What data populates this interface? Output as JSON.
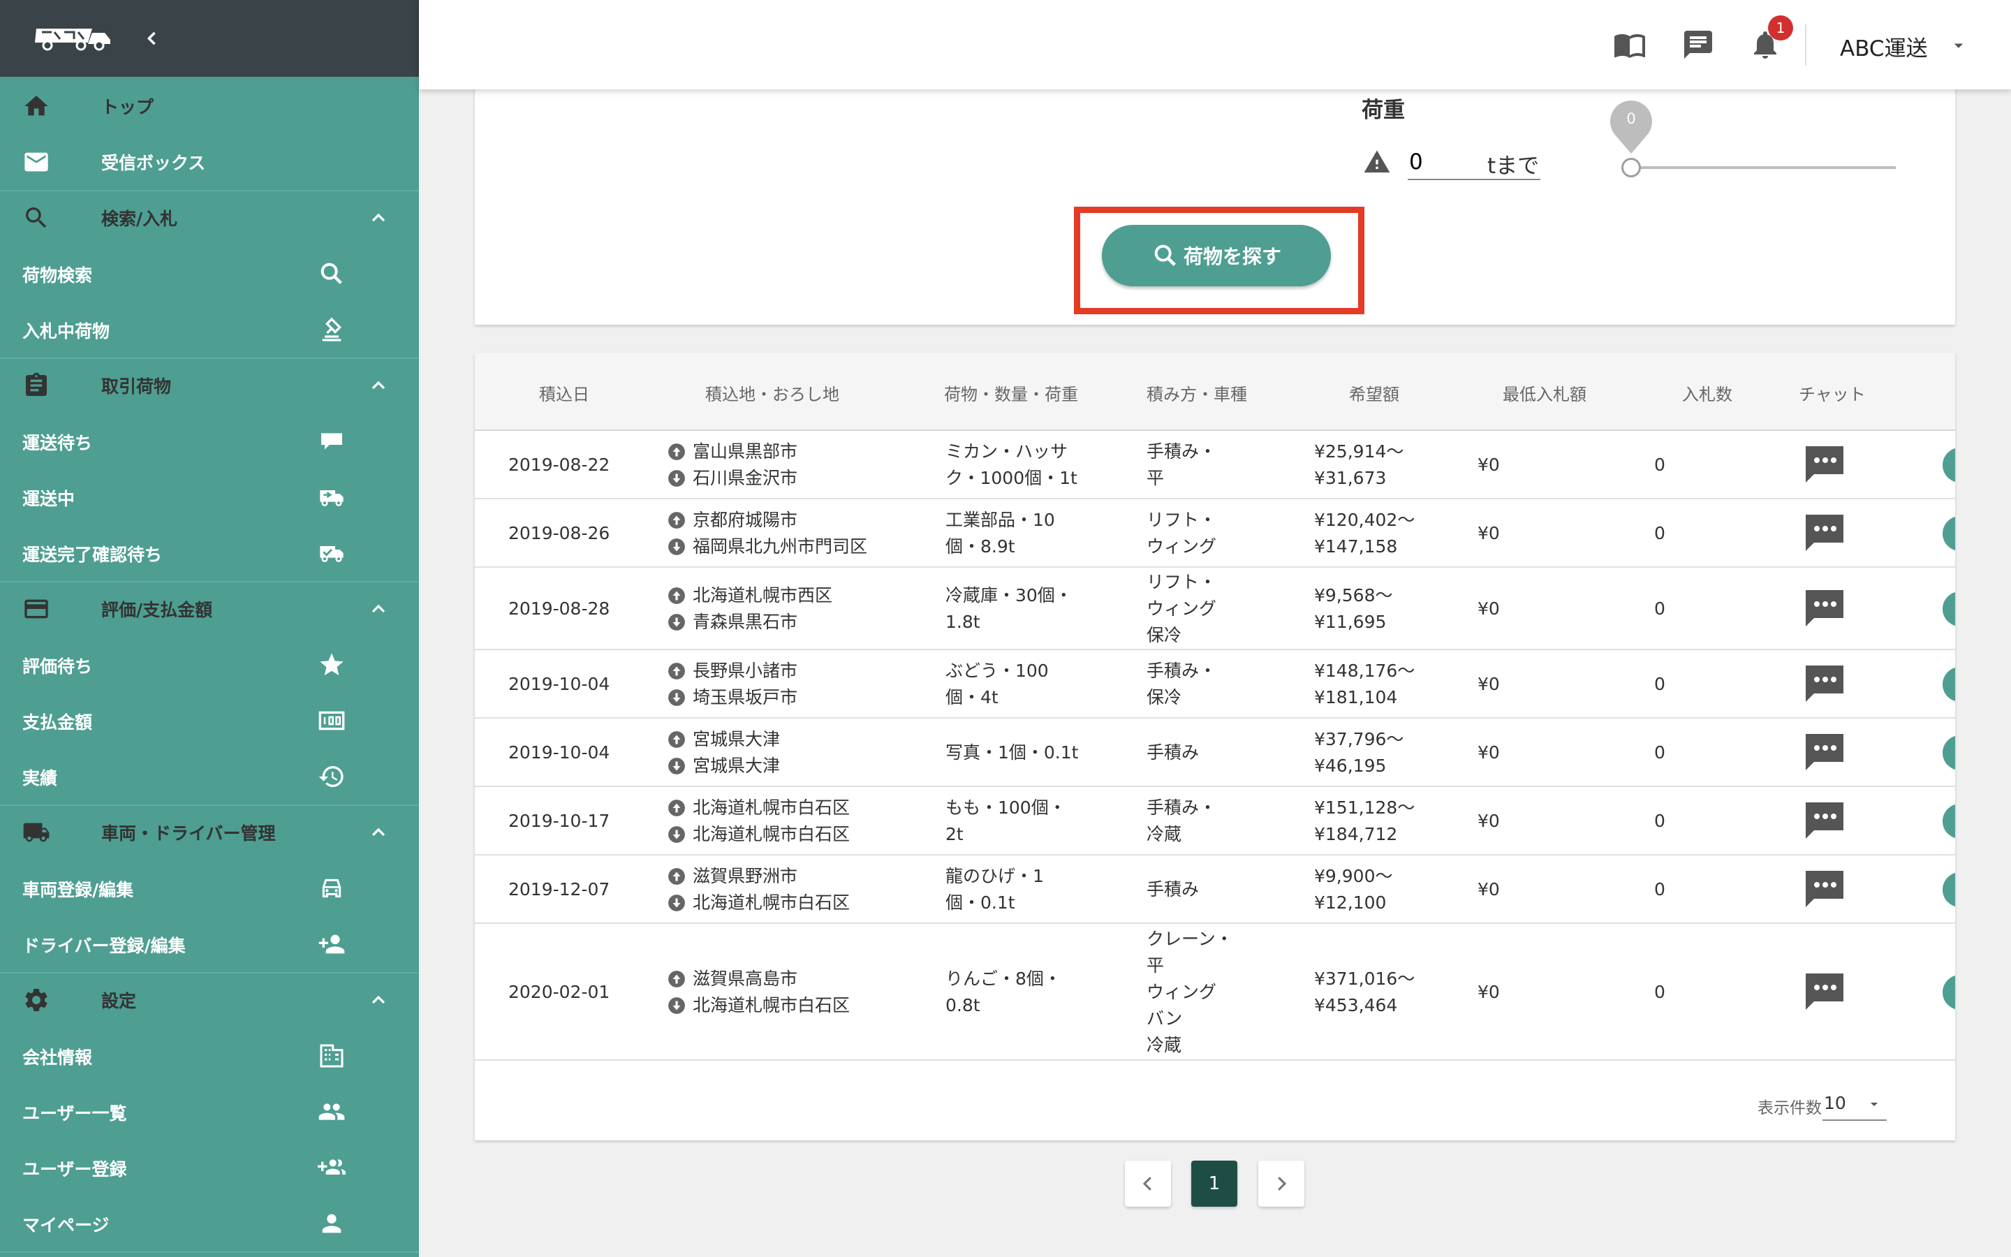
{
  "sidebar": {
    "items": [
      {
        "label": "トップ",
        "icon": "home-icon"
      },
      {
        "label": "受信ボックス",
        "icon": "mail-icon"
      }
    ],
    "groups": [
      {
        "label": "検索/入札",
        "icon": "search-icon",
        "children": [
          {
            "label": "荷物検索",
            "icon": "search-icon"
          },
          {
            "label": "入札中荷物",
            "icon": "bid-icon"
          }
        ]
      },
      {
        "label": "取引荷物",
        "icon": "clipboard-icon",
        "children": [
          {
            "label": "運送待ち",
            "icon": "truck-waiting-icon"
          },
          {
            "label": "運送中",
            "icon": "truck-moving-icon"
          },
          {
            "label": "運送完了確認待ち",
            "icon": "truck-check-icon"
          }
        ]
      },
      {
        "label": "評価/支払金額",
        "icon": "card-icon",
        "children": [
          {
            "label": "評価待ち",
            "icon": "star-icon"
          },
          {
            "label": "支払金額",
            "icon": "money-icon"
          },
          {
            "label": "実績",
            "icon": "history-icon"
          }
        ]
      },
      {
        "label": "車両・ドライバー管理",
        "icon": "truck-icon",
        "children": [
          {
            "label": "車両登録/編集",
            "icon": "car-icon"
          },
          {
            "label": "ドライバー登録/編集",
            "icon": "person-add-icon"
          }
        ]
      },
      {
        "label": "設定",
        "icon": "gear-icon",
        "children": [
          {
            "label": "会社情報",
            "icon": "building-icon"
          },
          {
            "label": "ユーザー一覧",
            "icon": "people-icon"
          },
          {
            "label": "ユーザー登録",
            "icon": "group-add-icon"
          },
          {
            "label": "マイページ",
            "icon": "person-icon"
          }
        ]
      }
    ]
  },
  "header": {
    "notification_count": "1",
    "company": "ABC運送"
  },
  "search": {
    "load_label": "荷重",
    "weight_value": "0",
    "weight_unit": "tまで",
    "slider_value": "0",
    "button_label": "荷物を探す"
  },
  "table": {
    "columns": [
      "積込日",
      "積込地・おろし地",
      "荷物・数量・荷重",
      "積み方・車種",
      "希望額",
      "最低入札額",
      "入札数",
      "チャット"
    ],
    "rows": [
      {
        "date": "2019-08-22",
        "origin": "富山県黒部市",
        "dest": "石川県金沢市",
        "cargo": [
          "ミカン・ハッサ",
          "ク・1000個・1t"
        ],
        "method": [
          "手積み・",
          "平"
        ],
        "price_min": "¥25,914〜",
        "price_max": "¥31,673",
        "min_bid": "¥0",
        "bids": "0"
      },
      {
        "date": "2019-08-26",
        "origin": "京都府城陽市",
        "dest": "福岡県北九州市門司区",
        "cargo": [
          "工業部品・10",
          "個・8.9t"
        ],
        "method": [
          "リフト・",
          "ウィング"
        ],
        "price_min": "¥120,402〜",
        "price_max": "¥147,158",
        "min_bid": "¥0",
        "bids": "0"
      },
      {
        "date": "2019-08-28",
        "origin": "北海道札幌市西区",
        "dest": "青森県黒石市",
        "cargo": [
          "冷蔵庫・30個・",
          "1.8t"
        ],
        "method": [
          "リフト・",
          "ウィング",
          "保冷"
        ],
        "price_min": "¥9,568〜",
        "price_max": "¥11,695",
        "min_bid": "¥0",
        "bids": "0"
      },
      {
        "date": "2019-10-04",
        "origin": "長野県小諸市",
        "dest": "埼玉県坂戸市",
        "cargo": [
          "ぶどう・100",
          "個・4t"
        ],
        "method": [
          "手積み・",
          "保冷"
        ],
        "price_min": "¥148,176〜",
        "price_max": "¥181,104",
        "min_bid": "¥0",
        "bids": "0"
      },
      {
        "date": "2019-10-04",
        "origin": "宮城県大津",
        "dest": "宮城県大津",
        "cargo": [
          "写真・1個・0.1t"
        ],
        "method": [
          "手積み"
        ],
        "price_min": "¥37,796〜",
        "price_max": "¥46,195",
        "min_bid": "¥0",
        "bids": "0"
      },
      {
        "date": "2019-10-17",
        "origin": "北海道札幌市白石区",
        "dest": "北海道札幌市白石区",
        "cargo": [
          "もも・100個・",
          "2t"
        ],
        "method": [
          "手積み・",
          "冷蔵"
        ],
        "price_min": "¥151,128〜",
        "price_max": "¥184,712",
        "min_bid": "¥0",
        "bids": "0"
      },
      {
        "date": "2019-12-07",
        "origin": "滋賀県野洲市",
        "dest": "北海道札幌市白石区",
        "cargo": [
          "龍のひげ・1",
          "個・0.1t"
        ],
        "method": [
          "手積み"
        ],
        "price_min": "¥9,900〜",
        "price_max": "¥12,100",
        "min_bid": "¥0",
        "bids": "0"
      },
      {
        "date": "2020-02-01",
        "origin": "滋賀県高島市",
        "dest": "北海道札幌市白石区",
        "cargo": [
          "りんご・8個・",
          "0.8t"
        ],
        "method": [
          "クレーン・",
          "平",
          "ウィング",
          "バン",
          "冷蔵"
        ],
        "price_min": "¥371,016〜",
        "price_max": "¥453,464",
        "min_bid": "¥0",
        "bids": "0"
      }
    ],
    "per_page_label": "表示件数",
    "per_page_value": "10"
  },
  "pagination": {
    "current": "1"
  },
  "colors": {
    "accent": "#4e9e92",
    "sidebar_dark": "#3a4347",
    "highlight": "#e53a24",
    "badge": "#d32f2f",
    "active_page": "#1e4d45"
  }
}
